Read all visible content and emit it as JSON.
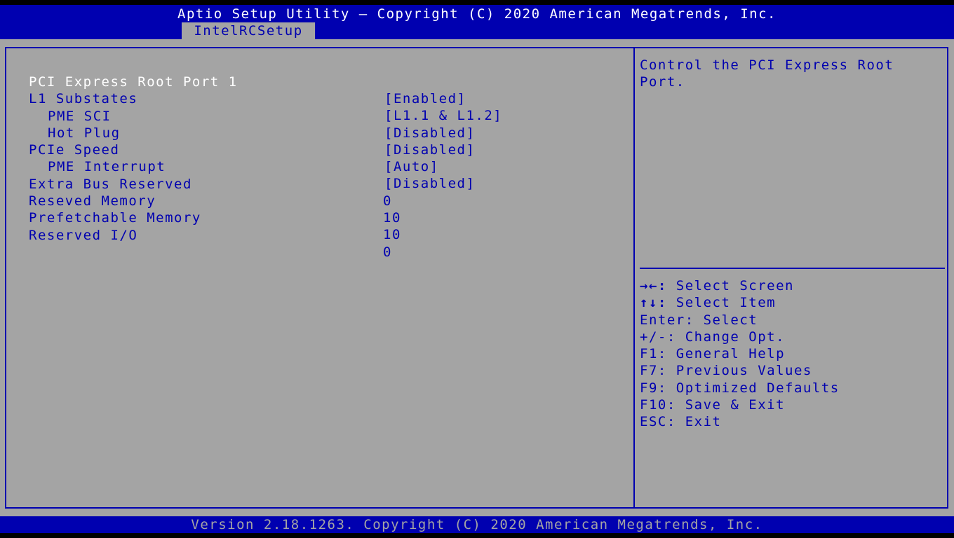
{
  "header": {
    "title": "Aptio Setup Utility – Copyright (C) 2020 American Megatrends, Inc.",
    "tab": "IntelRCSetup"
  },
  "settings": [
    {
      "label": "PCI Express Root Port 1",
      "value": "[Enabled]"
    },
    {
      "label": "L1 Substates",
      "value": "[L1.1 & L1.2]"
    },
    {
      "label": "PME SCI",
      "value": "[Disabled]"
    },
    {
      "label": "Hot Plug",
      "value": "[Disabled]"
    },
    {
      "label": "PCIe Speed",
      "value": "[Auto]"
    },
    {
      "label": "PME Interrupt",
      "value": "[Disabled]"
    },
    {
      "label": "Extra Bus Reserved",
      "value": "0"
    },
    {
      "label": "Reseved Memory",
      "value": "10"
    },
    {
      "label": "Prefetchable Memory",
      "value": "10"
    },
    {
      "label": "Reserved I/O",
      "value": "0"
    }
  ],
  "help": {
    "line1": "Control the PCI Express Root",
    "line2": "Port."
  },
  "keys": [
    {
      "key": "→←:",
      "desc": "Select Screen"
    },
    {
      "key": "↑↓:",
      "desc": "Select Item"
    },
    {
      "key": "Enter:",
      "desc": "Select"
    },
    {
      "key": "+/-:",
      "desc": "Change Opt."
    },
    {
      "key": "F1:",
      "desc": "General Help"
    },
    {
      "key": "F7:",
      "desc": "Previous Values"
    },
    {
      "key": "F9:",
      "desc": "Optimized Defaults"
    },
    {
      "key": "F10:",
      "desc": "Save & Exit"
    },
    {
      "key": "ESC:",
      "desc": "Exit"
    }
  ],
  "footer": {
    "text": "Version 2.18.1263. Copyright (C) 2020 American Megatrends, Inc."
  },
  "colors": {
    "blue": "#0000b0",
    "gray": "#a4a4a4",
    "white": "#ffffff"
  }
}
